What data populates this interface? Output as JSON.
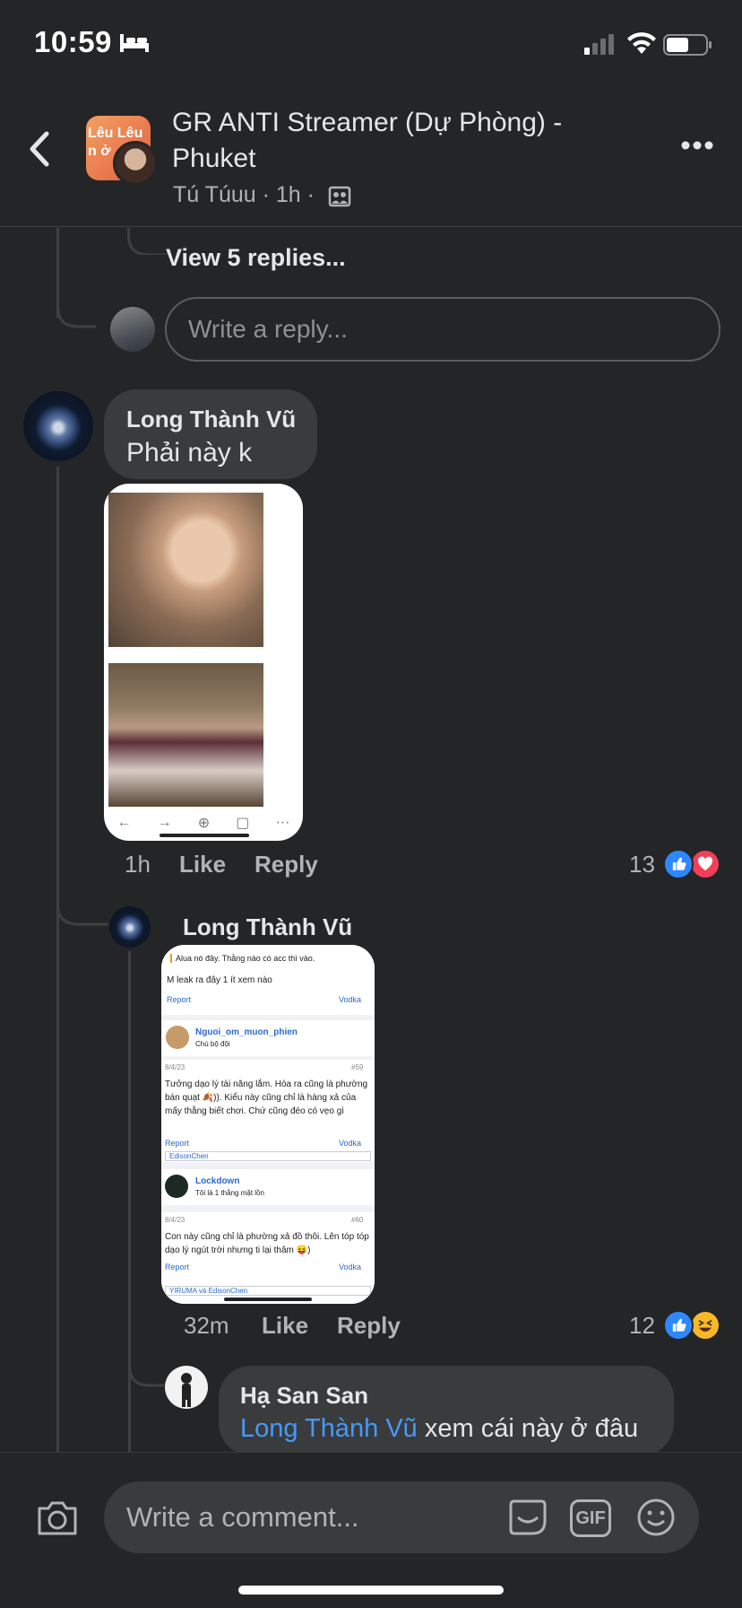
{
  "status_bar": {
    "time": "10:59"
  },
  "header": {
    "group_name": "GR ANTI Streamer (Dự Phòng) - Phuket",
    "avatar_text": "Lêu Lêu n ở",
    "poster": "Tú Túuu",
    "meta": "Tú Túuu · 1h ·"
  },
  "thread": {
    "view_replies": "View 5 replies...",
    "reply_placeholder": "Write a reply..."
  },
  "comments": [
    {
      "author": "Long Thành Vũ",
      "text": "Phải này k",
      "time": "1h",
      "like_label": "Like",
      "reply_label": "Reply",
      "reaction_count": "13"
    },
    {
      "author": "Long Thành Vũ",
      "time": "32m",
      "like_label": "Like",
      "reply_label": "Reply",
      "reaction_count": "12",
      "screenshot": {
        "quote": "Alua nó đây. Thằng nào có acc thì vào.",
        "line1": "M leak ra đây 1 ít xem nào",
        "report": "Report",
        "vodka": "Vodka",
        "user1": "Nguoi_om_muon_phien",
        "user1_sub": "Chú bộ đội",
        "date1": "8/4/23",
        "num1": "#59",
        "body1": "Tưởng dạo lý tài năng lắm. Hóa ra cũng là phường bán quạt 🍂)). Kiểu này cũng chỉ là hàng xả của mấy thằng biết chơi. Chứ cũng đéo có vẹo gì",
        "liker1": "EdisonChen",
        "user2": "Lockdown",
        "user2_sub": "Tôi là 1 thằng mặt lồn",
        "date2": "8/4/23",
        "num2": "#60",
        "body2": "Con này cũng chỉ là phường xả đồ thôi. Lên tóp tóp dạo lý ngút trời nhưng ti lại thâm 😝)",
        "liker2": "YIRUMA và EdisonChen"
      }
    },
    {
      "author": "Hạ San San",
      "mention": "Long Thành Vũ",
      "text": " xem cái này ở đâu"
    }
  ],
  "composer": {
    "placeholder": "Write a comment...",
    "gif_label": "GIF"
  },
  "colors": {
    "background": "#242526",
    "bubble": "#3a3b3c",
    "mention": "#4599ff",
    "like": "#2d88ff",
    "love": "#f33e58",
    "haha": "#f7b928"
  }
}
